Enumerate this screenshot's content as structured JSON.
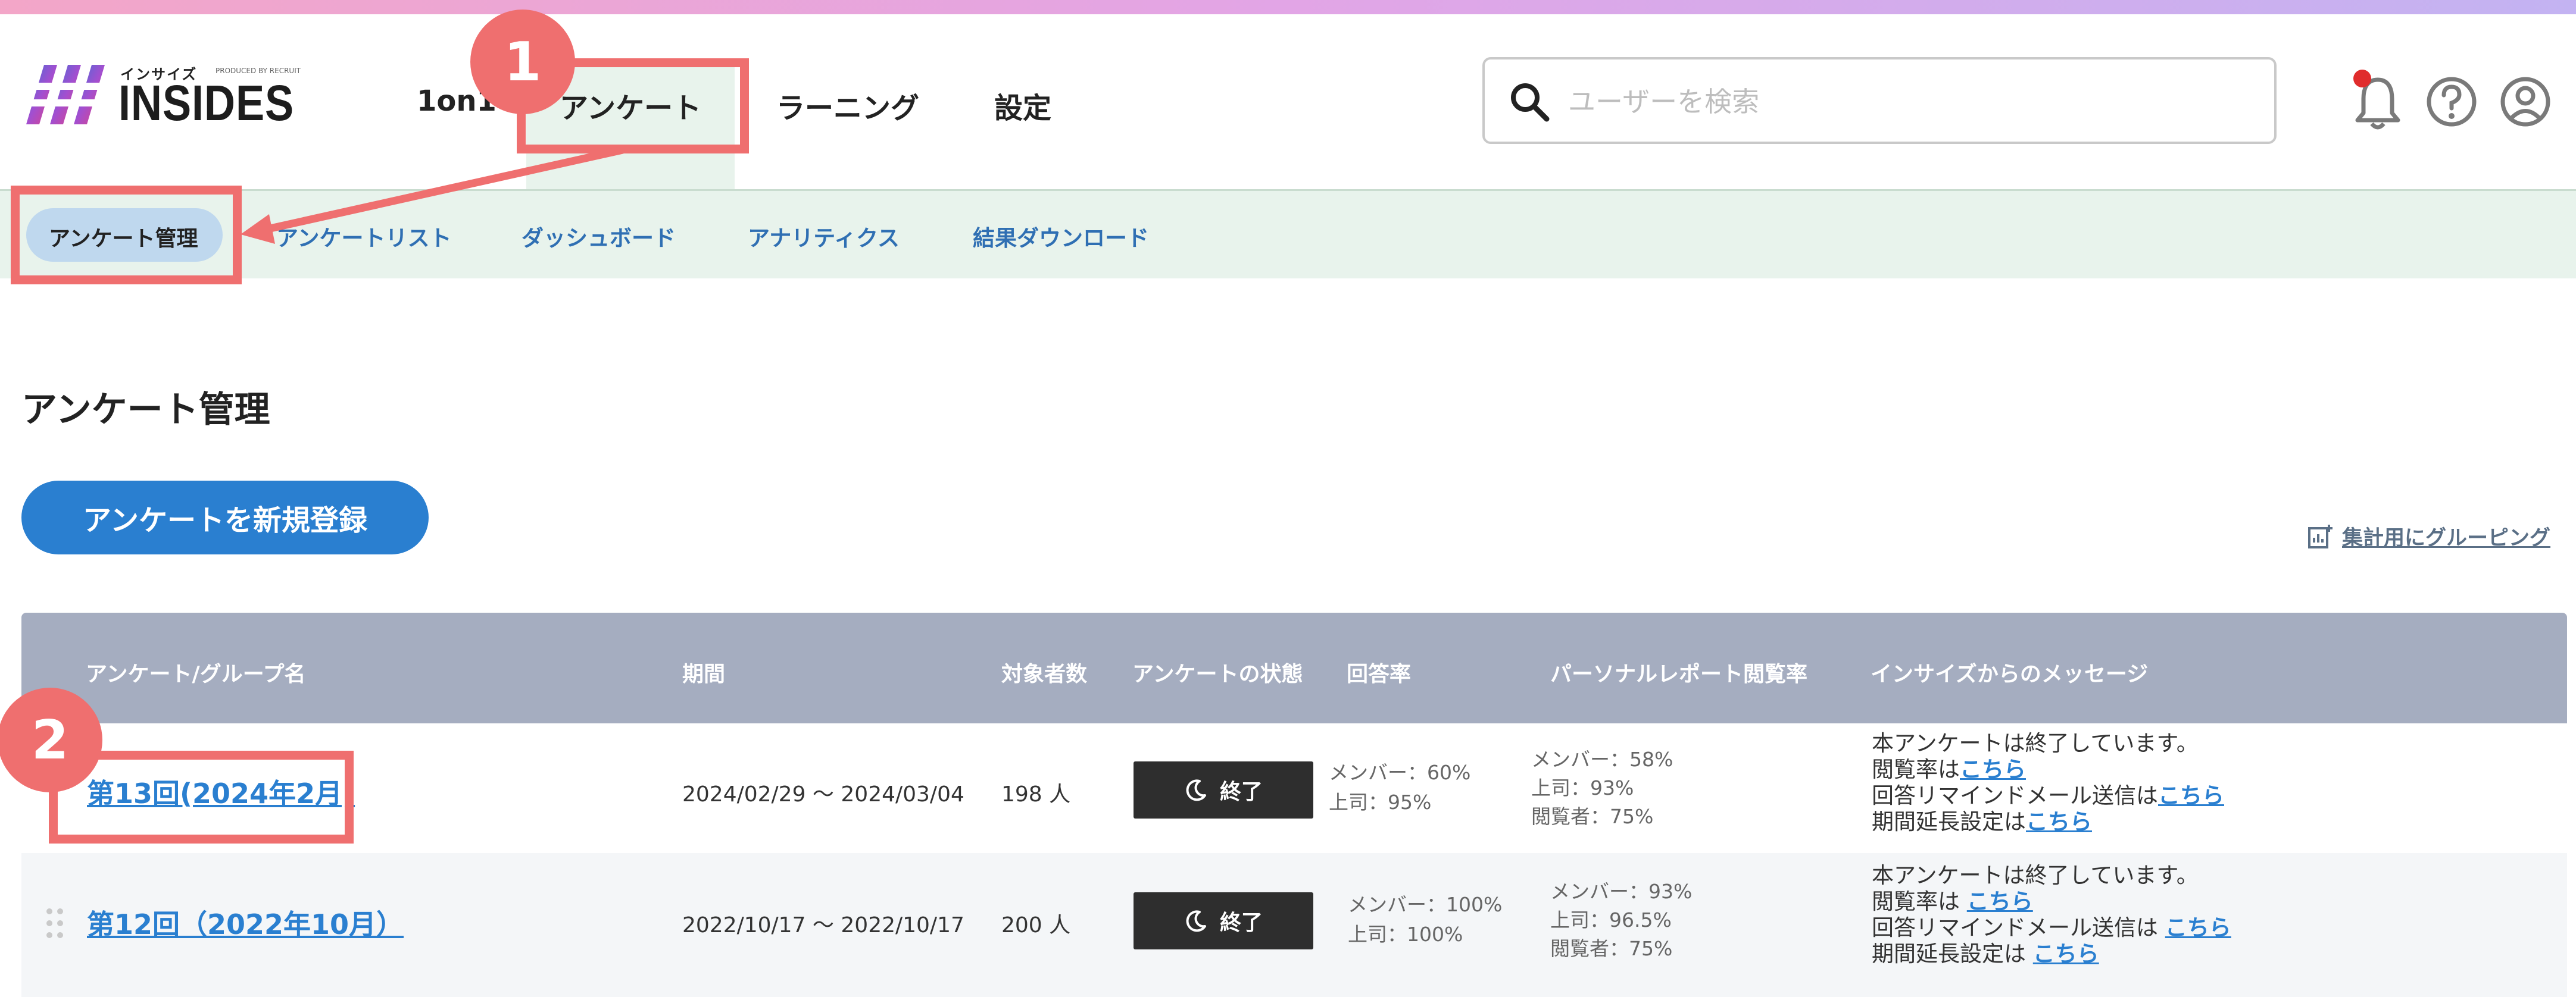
{
  "header": {
    "logo_small": "インサイズ",
    "logo_produced": "PRODUCED BY RECRUIT",
    "logo_text": "INSIDES",
    "nav": [
      "1on1",
      "アンケート",
      "ラーニング",
      "設定"
    ],
    "search_placeholder": "ユーザーを検索"
  },
  "subnav": {
    "items": [
      "アンケート管理",
      "アンケートリスト",
      "ダッシュボード",
      "アナリティクス",
      "結果ダウンロード"
    ]
  },
  "page": {
    "title": "アンケート管理",
    "new_button": "アンケートを新規登録",
    "group_link": "集計用にグルーピング"
  },
  "table": {
    "headers": [
      "アンケート/グループ名",
      "期間",
      "対象者数",
      "アンケートの状態",
      "回答率",
      "パーソナルレポート閲覧率",
      "インサイズからのメッセージ"
    ],
    "rows": [
      {
        "name": "第13回(2024年2月)",
        "period": "2024/02/29 ～ 2024/03/04",
        "count": "198 人",
        "status": "終了",
        "answer_member": "メンバー：60%",
        "answer_boss": "上司：95%",
        "view_member": "メンバー：58%",
        "view_boss": "上司：93%",
        "view_viewer": "閲覧者：75%",
        "msg_line1": "本アンケートは終了しています。",
        "msg_line2": "閲覧率は",
        "msg_line3": "回答リマインドメール送信は",
        "msg_line4": "期間延長設定は",
        "msg_link": "こちら"
      },
      {
        "name": "第12回（2022年10月）",
        "period": "2022/10/17 ～ 2022/10/17",
        "count": "200 人",
        "status": "終了",
        "answer_member": "メンバー：100%",
        "answer_boss": "上司：100%",
        "view_member": "メンバー：93%",
        "view_boss": "上司：96.5%",
        "view_viewer": "閲覧者：75%",
        "msg_line1": "本アンケートは終了しています。",
        "msg_line2": "閲覧率は",
        "msg_line3": "回答リマインドメール送信は",
        "msg_line4": "期間延長設定は",
        "msg_link": "こちら"
      }
    ]
  },
  "annotations": {
    "badge1": "1",
    "badge2": "2"
  },
  "colors": {
    "annotation": "#ef6f6f",
    "primary": "#2a7fd0",
    "subnav_bg": "#e8f3ec",
    "table_header": "#a5adc0"
  },
  "icons": [
    "logo-mark-icon",
    "search-icon",
    "bell-icon",
    "help-icon",
    "account-icon",
    "moon-icon",
    "drag-handle-icon",
    "chart-group-icon"
  ]
}
